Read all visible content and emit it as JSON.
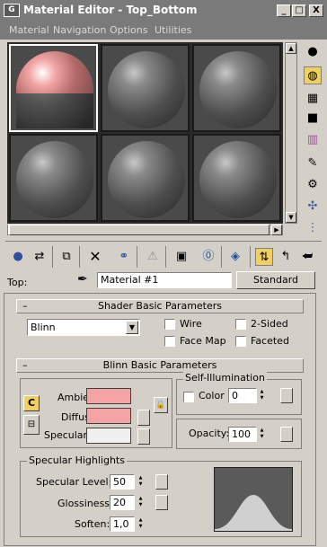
{
  "window": {
    "title": "Material Editor - Top_Bottom",
    "icon_text": "G",
    "min": "_",
    "max": "□",
    "close": "X"
  },
  "menu": [
    "Material",
    "Navigation",
    "Options",
    "Utilities"
  ],
  "toolbar": {
    "top_label": "Top:",
    "material_name": "Material #1",
    "type_button": "Standard"
  },
  "shader_basic": {
    "header": "Shader Basic Parameters",
    "shader": "Blinn",
    "wire": "Wire",
    "two_sided": "2-Sided",
    "face_map": "Face Map",
    "faceted": "Faceted"
  },
  "blinn_basic": {
    "header": "Blinn Basic Parameters",
    "ambient": "Ambient:",
    "diffuse": "Diffuse:",
    "specular": "Specular:",
    "lock_c": "C",
    "self_illum_title": "Self-Illumination",
    "color_label": "Color",
    "color_value": "0",
    "opacity_label": "Opacity:",
    "opacity_value": "100",
    "colors": {
      "ambient": "#f4a4a4",
      "diffuse": "#f4a4a4",
      "specular": "#f0f0f0"
    }
  },
  "specular_highlights": {
    "title": "Specular Highlights",
    "level_label": "Specular Level:",
    "level": "50",
    "gloss_label": "Glossiness:",
    "gloss": "20",
    "soften_label": "Soften:",
    "soften": "1,0"
  },
  "icons": {
    "right": [
      "sample-type-icon",
      "backlight-icon",
      "background-icon",
      "uv-tiling-icon",
      "video-color-icon",
      "make-preview-icon",
      "options-icon",
      "select-by-material-icon",
      "material-map-navigator-icon"
    ],
    "bottom": [
      "get-material-icon",
      "put-to-scene-icon",
      "assign-to-selection-icon",
      "reset-map-icon",
      "make-unique-icon",
      "put-to-library-icon",
      "material-id-icon",
      "show-map-icon",
      "show-end-result-icon",
      "go-to-parent-icon",
      "go-forward-icon",
      "pick-material-icon"
    ]
  }
}
